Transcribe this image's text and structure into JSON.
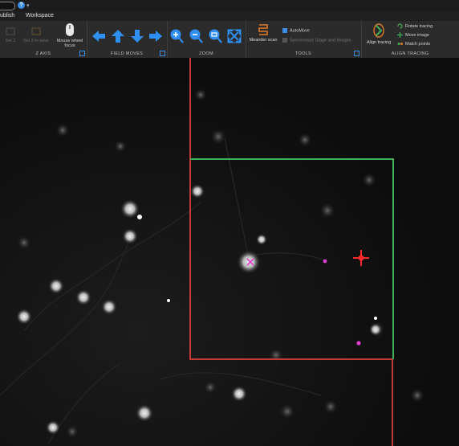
{
  "top": {
    "help_glyph": "?",
    "dropdown_glyph": "▾"
  },
  "menu": {
    "items": [
      "ublish",
      "Workspace"
    ]
  },
  "ribbon": {
    "zaxis": {
      "label": "Z AXIS",
      "set2_label": "Set 2",
      "set2_to_save_label": "Set 2 to save",
      "mouse_wheel_label": "Mouse wheel",
      "focus_label": "focus"
    },
    "field_moves": {
      "label": "FIELD MOVES"
    },
    "zoom": {
      "label": "ZOOM"
    },
    "tools": {
      "label": "TOOLS",
      "meander_label": "Meander scan",
      "automove_label": "AutoMove",
      "synchronize_label": "Synchronize Stage and Images"
    },
    "align": {
      "label": "ALIGN TRACING",
      "align_tracing_label": "Align tracing",
      "rotate_label": "Rotate tracing",
      "move_image_label": "Move image",
      "match_points_label": "Match points"
    }
  },
  "colors": {
    "accent_blue": "#2f8ff0",
    "frame_red": "#c43a36",
    "frame_green": "#3fb25a",
    "marker_red": "#ff2a2a",
    "marker_magenta": "#e040d0",
    "meander_orange": "#e07a28"
  },
  "icons": [
    "help-icon",
    "arrow-left-icon",
    "arrow-up-icon",
    "arrow-down-icon",
    "arrow-right-icon",
    "zoom-in-icon",
    "zoom-out-icon",
    "zoom-fit-icon",
    "fullscreen-icon",
    "mouse-icon",
    "meander-icon",
    "align-tracing-icon",
    "rotate-icon",
    "move-image-icon",
    "match-points-icon"
  ]
}
